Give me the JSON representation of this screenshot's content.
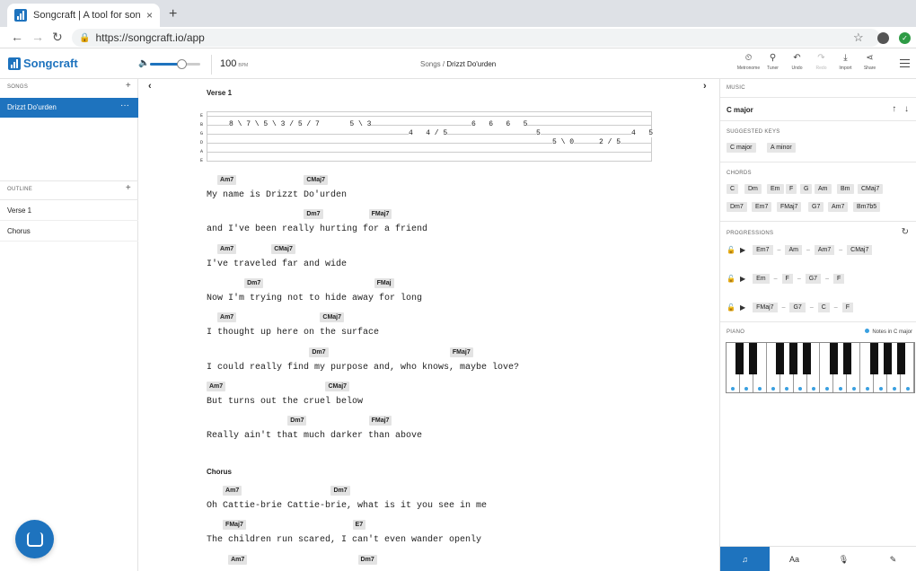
{
  "browser": {
    "tab_title": "Songcraft | A tool for songwriters",
    "tab_close": "×",
    "new_tab": "+",
    "url": "https://songcraft.io/app",
    "back": "←",
    "forward": "→",
    "reload": "↻",
    "star": "☆"
  },
  "app": {
    "logo": "Songcraft",
    "bpm_value": "100",
    "bpm_unit": "BPM",
    "volume_level": 0.63,
    "breadcrumb_parent": "Songs /",
    "breadcrumb_current": "Drizzt Do'urden",
    "tools": [
      {
        "label": "Metronome",
        "icon": "metronome-icon",
        "glyph": "⏲"
      },
      {
        "label": "Tuner",
        "icon": "tuner-icon",
        "glyph": "⚲"
      },
      {
        "label": "Undo",
        "icon": "undo-icon",
        "glyph": "↶"
      },
      {
        "label": "Redo",
        "icon": "redo-icon",
        "glyph": "↷"
      },
      {
        "label": "Import",
        "icon": "import-icon",
        "glyph": "⤓"
      },
      {
        "label": "Share",
        "icon": "share-icon",
        "glyph": "⋖"
      }
    ]
  },
  "left": {
    "songs_header": "SONGS",
    "song": "Drizzt Do'urden",
    "song_more": "···",
    "outline_header": "OUTLINE",
    "outline": [
      "Verse 1",
      "Chorus"
    ],
    "plus": "+"
  },
  "editor": {
    "prev": "‹",
    "next": "›",
    "verse_label": "Verse 1",
    "chorus_label": "Chorus",
    "tab_strings": [
      "E",
      "B",
      "G",
      "D",
      "A",
      "E"
    ],
    "tab_rows": [
      {
        "text": "8 \\ 7 \\ 5 \\ 3 / 5 / 7       5 \\ 3",
        "string": 1,
        "col": 0
      },
      {
        "text": "6   6   6   5",
        "string": 1,
        "col": 270
      },
      {
        "text": "4   4 / 5",
        "string": 2,
        "col": 200
      },
      {
        "text": "5",
        "string": 2,
        "col": 342
      },
      {
        "text": "4   5",
        "string": 2,
        "col": 448
      },
      {
        "text": "5 \\ 0",
        "string": 3,
        "col": 360
      },
      {
        "text": "2 / 5",
        "string": 3,
        "col": 412
      }
    ],
    "lines": [
      {
        "lyric": "My name is Drizzt Do'urden",
        "chords": [
          {
            "c": "Am7",
            "at": 2
          },
          {
            "c": "CMaj7",
            "at": 18
          }
        ]
      },
      {
        "lyric": "and I've been really hurting for a friend",
        "chords": [
          {
            "c": "Dm7",
            "at": 18
          },
          {
            "c": "FMaj7",
            "at": 30
          }
        ]
      },
      {
        "lyric": "I've traveled far and wide",
        "chords": [
          {
            "c": "Am7",
            "at": 2
          },
          {
            "c": "CMaj7",
            "at": 12
          }
        ]
      },
      {
        "lyric": "Now I'm trying not to hide away for long",
        "chords": [
          {
            "c": "Dm7",
            "at": 7
          },
          {
            "c": "FMaj",
            "at": 31
          }
        ]
      },
      {
        "lyric": "I thought up here on the surface",
        "chords": [
          {
            "c": "Am7",
            "at": 2
          },
          {
            "c": "CMaj7",
            "at": 21
          }
        ]
      },
      {
        "lyric": "I could really find my purpose and, who knows, maybe love?",
        "chords": [
          {
            "c": "Dm7",
            "at": 19
          },
          {
            "c": "FMaj7",
            "at": 45
          }
        ]
      },
      {
        "lyric": "But turns out the cruel below",
        "chords": [
          {
            "c": "Am7",
            "at": 0
          },
          {
            "c": "CMaj7",
            "at": 22
          }
        ]
      },
      {
        "lyric": "Really ain't that much darker than above",
        "chords": [
          {
            "c": "Dm7",
            "at": 15
          },
          {
            "c": "FMaj7",
            "at": 30
          }
        ]
      }
    ],
    "chorus_lines": [
      {
        "lyric": "Oh Cattie-brie Cattie-brie, what is it you see in me",
        "chords": [
          {
            "c": "Am7",
            "at": 3
          },
          {
            "c": "Dm7",
            "at": 23
          }
        ]
      },
      {
        "lyric": "The children run scared, I can't even wander openly",
        "chords": [
          {
            "c": "FMaj7",
            "at": 3
          },
          {
            "c": "E7",
            "at": 27
          }
        ]
      },
      {
        "lyric": "",
        "chords": [
          {
            "c": "Am7",
            "at": 4
          },
          {
            "c": "Dm7",
            "at": 28
          }
        ]
      }
    ]
  },
  "right": {
    "music_header": "MUSIC",
    "key": "C major",
    "key_up": "↑",
    "key_down": "↓",
    "suggested_header": "SUGGESTED KEYS",
    "suggested": [
      "C major",
      "A minor"
    ],
    "chords_header": "CHORDS",
    "chords_row1": [
      "C",
      "Dm",
      "Em",
      "F",
      "G",
      "Am",
      "Bm",
      "CMaj7"
    ],
    "chords_row2": [
      "Dm7",
      "Em7",
      "FMaj7",
      "G7",
      "Am7",
      "Bm7b5"
    ],
    "progressions_header": "PROGRESSIONS",
    "progressions": [
      [
        "Em7",
        "Am",
        "Am7",
        "CMaj7"
      ],
      [
        "Em",
        "F",
        "G7",
        "F"
      ],
      [
        "FMaj7",
        "G7",
        "C",
        "F"
      ]
    ],
    "piano_header": "PIANO",
    "piano_legend": "Notes in C major",
    "white_keys": 14,
    "bottom_tabs": [
      {
        "glyph": "♫",
        "name": "music-tab"
      },
      {
        "glyph": "Aa",
        "name": "text-tab"
      },
      {
        "glyph": "🎙",
        "name": "mic-tab"
      },
      {
        "glyph": "✎",
        "name": "notes-tab"
      }
    ],
    "colors": {
      "accent": "#1e73be",
      "note_dot": "#3aa0e0"
    }
  }
}
